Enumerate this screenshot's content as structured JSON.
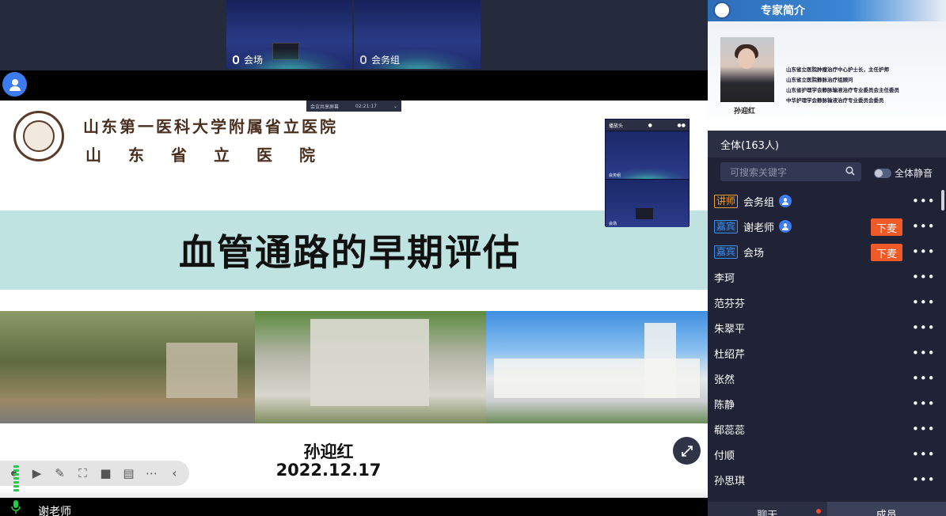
{
  "top_videos": [
    {
      "label": "会场"
    },
    {
      "label": "会务组"
    }
  ],
  "timer": "02:21:17",
  "timer_prefix": "会议共享屏幕",
  "slide": {
    "hospital_name_1": "山东第一医科大学附属省立医院",
    "hospital_name_2": "山东省立医院",
    "title": "血管通路的早期评估",
    "presenter": "孙迎红",
    "date": "2022.12.17"
  },
  "mini_video": {
    "header": "播放头",
    "cells": [
      {
        "label": "会务组"
      },
      {
        "label": "会场"
      }
    ]
  },
  "bottom_speaker": "谢老师",
  "panel": {
    "expert_title": "专家简介",
    "expert_name": "孙迎红",
    "expert_lines": [
      "山东省立医院肿瘤治疗中心护士长，主任护师",
      "山东省立医院静脉治疗组顾问",
      "山东省护理学会静脉输液治疗专业委员会主任委员",
      "中华护理学会静脉输液治疗专业委员会委员"
    ],
    "all_count": "全体(163人)",
    "search_placeholder": "可搜索关键字",
    "mute_all": "全体静音",
    "members": [
      {
        "role": "讲师",
        "role_type": "speaker",
        "name": "会务组",
        "icon": true,
        "action": ""
      },
      {
        "role": "嘉宾",
        "role_type": "guest",
        "name": "谢老师",
        "icon": true,
        "action": "下麦"
      },
      {
        "role": "嘉宾",
        "role_type": "guest",
        "name": "会场",
        "icon": false,
        "action": "下麦"
      },
      {
        "role": "",
        "role_type": "",
        "name": "李珂",
        "icon": false,
        "action": ""
      },
      {
        "role": "",
        "role_type": "",
        "name": "范芬芬",
        "icon": false,
        "action": ""
      },
      {
        "role": "",
        "role_type": "",
        "name": "朱翠平",
        "icon": false,
        "action": ""
      },
      {
        "role": "",
        "role_type": "",
        "name": "杜绍芹",
        "icon": false,
        "action": ""
      },
      {
        "role": "",
        "role_type": "",
        "name": "张然",
        "icon": false,
        "action": ""
      },
      {
        "role": "",
        "role_type": "",
        "name": "陈静",
        "icon": false,
        "action": ""
      },
      {
        "role": "",
        "role_type": "",
        "name": "郗蕊蕊",
        "icon": false,
        "action": ""
      },
      {
        "role": "",
        "role_type": "",
        "name": "付顺",
        "icon": false,
        "action": ""
      },
      {
        "role": "",
        "role_type": "",
        "name": "孙思琪",
        "icon": false,
        "action": ""
      }
    ],
    "more_label": "•••",
    "tabs": {
      "chat": "聊天",
      "members": "成员"
    }
  },
  "colors": {
    "accent": "#3c7bf0",
    "danger": "#f05a28",
    "speaker": "#f0a030"
  }
}
